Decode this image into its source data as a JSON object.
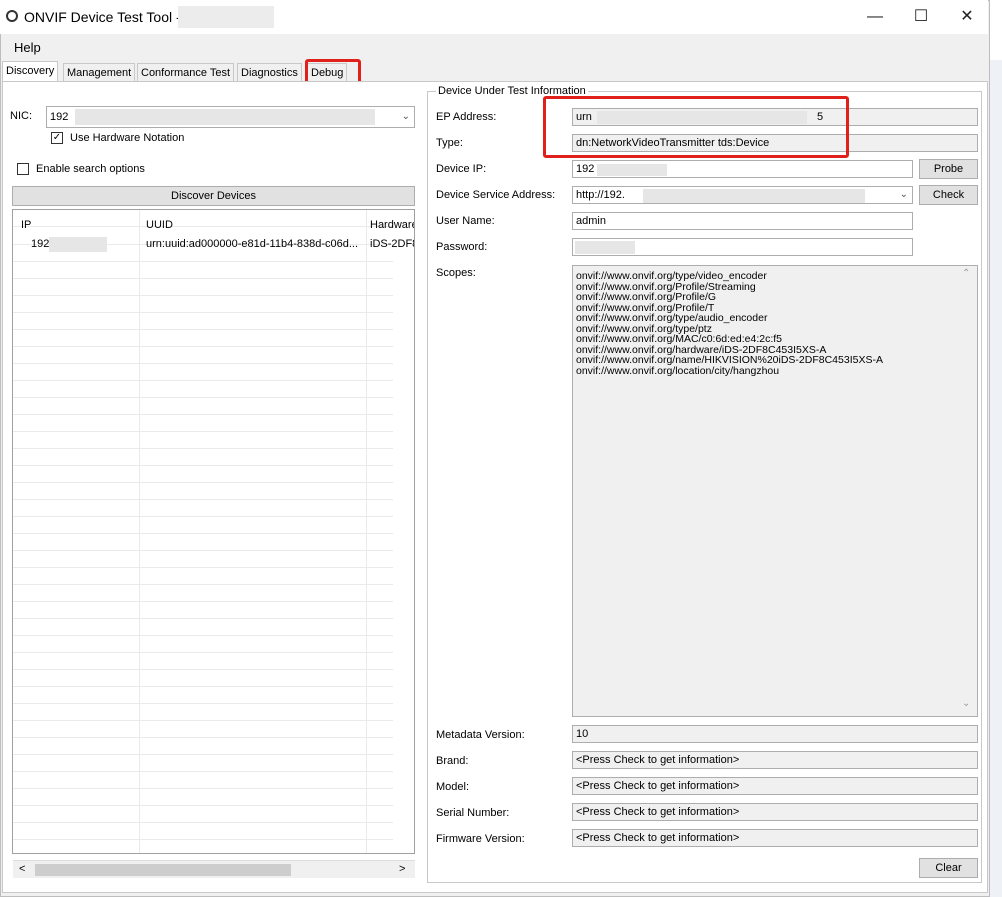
{
  "window": {
    "title": "ONVIF Device Test Tool -",
    "controls": {
      "minimize": "—",
      "maximize": "☐",
      "close": "✕"
    }
  },
  "menu": {
    "help": "Help"
  },
  "tabs": [
    "Discovery",
    "Management",
    "Conformance Test",
    "Diagnostics",
    "Debug"
  ],
  "discovery": {
    "nic_label": "NIC:",
    "nic_value": "192",
    "use_hw_notation": "Use Hardware Notation",
    "use_hw_checked": "✓",
    "enable_search": "Enable search options",
    "discover_button": "Discover Devices",
    "columns": [
      "IP",
      "UUID",
      "Hardware"
    ],
    "rows": [
      {
        "ip": "192",
        "uuid": "urn:uuid:ad000000-e81d-11b4-838d-c06d...",
        "hardware": "iDS-2DF8"
      }
    ],
    "scroll_left": "<",
    "scroll_right": ">"
  },
  "dut": {
    "group_title": "Device Under Test Information",
    "ep_label": "EP Address:",
    "ep_value": "urn",
    "ep_suffix": "5",
    "type_label": "Type:",
    "type_value": "dn:NetworkVideoTransmitter tds:Device",
    "ip_label": "Device IP:",
    "ip_value": "192",
    "probe_button": "Probe",
    "service_label": "Device Service Address:",
    "service_value": "http://192.",
    "check_button": "Check",
    "user_label": "User Name:",
    "user_value": "admin",
    "password_label": "Password:",
    "scopes_label": "Scopes:",
    "scopes": [
      "onvif://www.onvif.org/type/video_encoder",
      "onvif://www.onvif.org/Profile/Streaming",
      "onvif://www.onvif.org/Profile/G",
      "onvif://www.onvif.org/Profile/T",
      "onvif://www.onvif.org/type/audio_encoder",
      "onvif://www.onvif.org/type/ptz",
      "onvif://www.onvif.org/MAC/c0:6d:ed:e4:2c:f5",
      "onvif://www.onvif.org/hardware/iDS-2DF8C453I5XS-A",
      "onvif://www.onvif.org/name/HIKVISION%20iDS-2DF8C453I5XS-A",
      "onvif://www.onvif.org/location/city/hangzhou"
    ],
    "metadata_label": "Metadata Version:",
    "metadata_value": "10",
    "brand_label": "Brand:",
    "brand_value": "<Press Check to get information>",
    "model_label": "Model:",
    "model_value": "<Press Check to get information>",
    "serial_label": "Serial Number:",
    "serial_value": "<Press Check to get information>",
    "firmware_label": "Firmware Version:",
    "firmware_value": "<Press Check to get information>",
    "clear_button": "Clear"
  },
  "colors": {
    "highlight": "#e0201b",
    "field_bg": "#f0f0f0",
    "window_bg": "#f0f0f0"
  }
}
